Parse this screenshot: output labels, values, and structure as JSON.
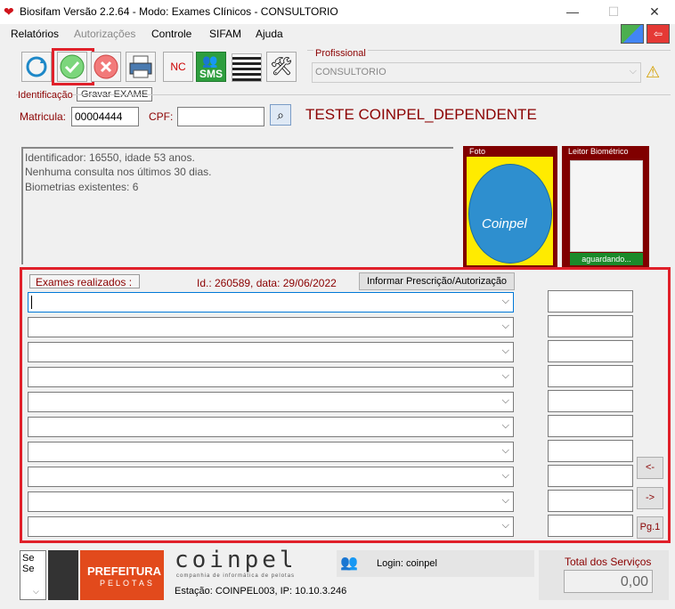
{
  "window": {
    "title": "Biosifam Versão 2.2.64 - Modo: Exames Clínicos - CONSULTORIO",
    "minimize": "—",
    "maximize": "☐",
    "close": "✕"
  },
  "menu": {
    "items": [
      "Relatórios",
      "Autorizações",
      "Controle",
      "SIFAM",
      "Ajuda"
    ]
  },
  "toolbar": {
    "nc_label": "NC",
    "sms_label": "SMS",
    "tooltip": "Gravar EXAME"
  },
  "profissional": {
    "label": "Profissional",
    "value": "CONSULTORIO"
  },
  "identificacao": {
    "label": "Identificação",
    "matricula_label": "Matricula:",
    "matricula_value": "00004444",
    "cpf_label": "CPF:",
    "cpf_value": "",
    "patient_name": "TESTE COINPEL_DEPENDENTE"
  },
  "info": {
    "line1": "Identificador: 16550, idade 53 anos.",
    "line2": "Nenhuma consulta nos últimos 30 dias.",
    "line3": "Biometrias existentes: 6"
  },
  "foto": {
    "label": "Foto",
    "logo_text": "Coinpel"
  },
  "leitor": {
    "label": "Leitor Biométrico",
    "status": "aguardando..."
  },
  "exames": {
    "label": "Exames realizados :",
    "id_info": "Id.: 260589, data: 29/06/2022",
    "informar_button": "Informar Prescrição/Autorização",
    "rows": 10
  },
  "nav": {
    "prev": "<-",
    "next": "->",
    "page": "Pg.1"
  },
  "footer": {
    "se1": "Se",
    "se2": "Se",
    "prefeitura_line1": "PREFEITURA",
    "prefeitura_line2": "PELOTAS",
    "coinpel_logo": "coinpel",
    "coinpel_sub": "companhia de informática de pelotas",
    "login": "Login: coinpel",
    "estacao": "Estação: COINPEL003, IP: 10.10.3.246",
    "total_label": "Total dos Serviços",
    "total_value": "0,00"
  },
  "colors": {
    "accent_red": "#e0202a",
    "dark_red": "#8b0000",
    "coinpel_blue": "#1e88c8"
  }
}
